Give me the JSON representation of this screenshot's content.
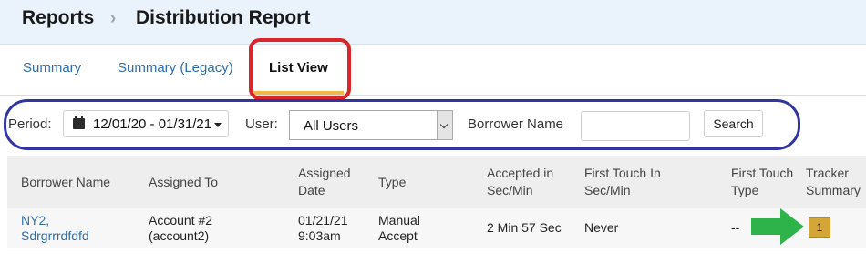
{
  "breadcrumb": {
    "root": "Reports",
    "separator": "›",
    "current": "Distribution Report"
  },
  "tabs": [
    {
      "label": "Summary",
      "active": false
    },
    {
      "label": "Summary (Legacy)",
      "active": false
    },
    {
      "label": "List View",
      "active": true
    }
  ],
  "filters": {
    "period_label": "Period:",
    "period_value": "12/01/20 - 01/31/21",
    "user_label": "User:",
    "user_value": "All Users",
    "borrower_label": "Borrower Name",
    "borrower_value": "",
    "search_label": "Search"
  },
  "table": {
    "headers": [
      [
        "Borrower Name"
      ],
      [
        "Assigned To"
      ],
      [
        "Assigned",
        "Date"
      ],
      [
        "Type"
      ],
      [
        "Accepted in",
        "Sec/Min"
      ],
      [
        "First Touch In",
        "Sec/Min"
      ],
      [
        "First Touch",
        "Type"
      ],
      [
        "Tracker",
        "Summary"
      ]
    ],
    "rows": [
      {
        "borrower_name": [
          "NY2,",
          "Sdrgrrrdfdfd"
        ],
        "assigned_to": [
          "Account #2",
          "(account2)"
        ],
        "assigned_date": [
          "01/21/21",
          "9:03am"
        ],
        "type": [
          "Manual",
          "Accept"
        ],
        "accepted_in": "2 Min 57 Sec",
        "first_touch_in": "Never",
        "first_touch_type": "--",
        "tracker_summary": "1"
      }
    ]
  },
  "colors": {
    "header_bg": "#eaf2fb",
    "link": "#2f6ea7",
    "active_tab_underline": "#f0b84a",
    "annotation_red": "#d9262b",
    "annotation_blue": "#3334a3",
    "annotation_green": "#2db34a",
    "tracker_badge": "#d4a637"
  }
}
